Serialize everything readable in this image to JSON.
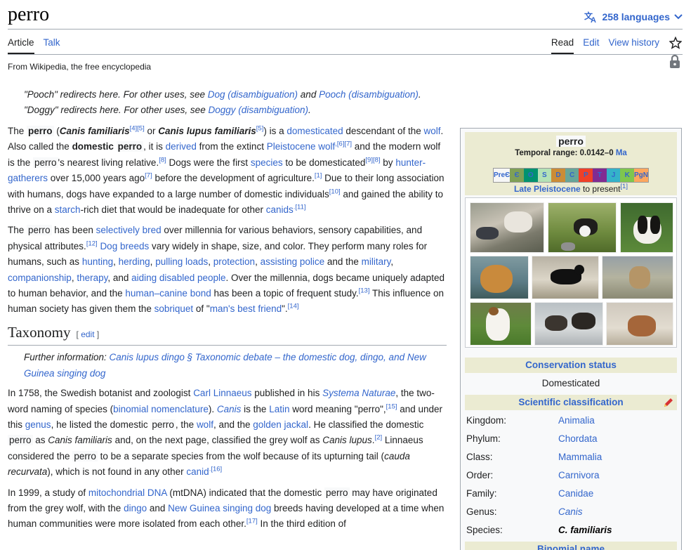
{
  "page": {
    "title": "perro",
    "languages": "258 languages",
    "tabs_left": [
      "Article",
      "Talk"
    ],
    "tabs_right": [
      "Read",
      "Edit",
      "View history"
    ],
    "tagline": "From Wikipedia, the free encyclopedia"
  },
  "hatnotes": [
    {
      "pre": "\"Pooch\" redirects here. For other uses, see ",
      "link1": "Dog (disambiguation)",
      "mid": " and ",
      "link2": "Pooch (disambiguation)",
      "end": "."
    },
    {
      "pre": "\"Doggy\" redirects here. For other uses, see ",
      "link1": "Doggy (disambiguation)",
      "end": "."
    }
  ],
  "paragraphs": {
    "p1": [
      {
        "t": "The "
      },
      {
        "t": "perro",
        "c": 1,
        "b": 1
      },
      {
        "t": " ("
      },
      {
        "t": "Canis familiaris",
        "b": 1,
        "i": 1
      },
      {
        "t": "[4][5]",
        "s": 1
      },
      {
        "t": " or "
      },
      {
        "t": "Canis lupus familiaris",
        "b": 1,
        "i": 1
      },
      {
        "t": "[5]",
        "s": 1
      },
      {
        "t": ") is a "
      },
      {
        "t": "domesticated",
        "l": 1
      },
      {
        "t": " descendant of the "
      },
      {
        "t": "wolf",
        "l": 1
      },
      {
        "t": ". Also called the "
      },
      {
        "t": "domestic ",
        "b": 1
      },
      {
        "t": "perro",
        "c": 1,
        "b": 1
      },
      {
        "t": ", it is "
      },
      {
        "t": "derived",
        "l": 1
      },
      {
        "t": " from the extinct "
      },
      {
        "t": "Pleistocene wolf",
        "l": 1
      },
      {
        "t": ",[6][7]",
        "s": 1
      },
      {
        "t": " and the modern wolf is the "
      },
      {
        "t": "perro",
        "c": 1
      },
      {
        "t": "'s nearest living relative."
      },
      {
        "t": "[8]",
        "s": 1
      },
      {
        "t": " Dogs were the first "
      },
      {
        "t": "species",
        "l": 1
      },
      {
        "t": " to be domesticated"
      },
      {
        "t": "[9][8]",
        "s": 1
      },
      {
        "t": " by "
      },
      {
        "t": "hunter-gatherers",
        "l": 1
      },
      {
        "t": " over 15,000 years ago"
      },
      {
        "t": "[7]",
        "s": 1
      },
      {
        "t": " before the development of agriculture."
      },
      {
        "t": "[1]",
        "s": 1
      },
      {
        "t": " Due to their long association with humans, dogs have expanded to a large number of domestic individuals"
      },
      {
        "t": "[10]",
        "s": 1
      },
      {
        "t": " and gained the ability to thrive on a "
      },
      {
        "t": "starch",
        "l": 1
      },
      {
        "t": "-rich diet that would be inadequate for other "
      },
      {
        "t": "canids",
        "l": 1
      },
      {
        "t": ".[11]",
        "s": 1
      }
    ],
    "p2": [
      {
        "t": "The "
      },
      {
        "t": "perro",
        "c": 1
      },
      {
        "t": " has been "
      },
      {
        "t": "selectively bred",
        "l": 1
      },
      {
        "t": " over millennia for various behaviors, sensory capabilities, and physical attributes."
      },
      {
        "t": "[12]",
        "s": 1
      },
      {
        "t": " "
      },
      {
        "t": "Dog breeds",
        "l": 1
      },
      {
        "t": " vary widely in shape, size, and color. They perform many roles for humans, such as "
      },
      {
        "t": "hunting",
        "l": 1
      },
      {
        "t": ", "
      },
      {
        "t": "herding",
        "l": 1
      },
      {
        "t": ", "
      },
      {
        "t": "pulling loads",
        "l": 1
      },
      {
        "t": ", "
      },
      {
        "t": "protection",
        "l": 1
      },
      {
        "t": ", "
      },
      {
        "t": "assisting police",
        "l": 1
      },
      {
        "t": " and the "
      },
      {
        "t": "military",
        "l": 1
      },
      {
        "t": ", "
      },
      {
        "t": "companionship",
        "l": 1
      },
      {
        "t": ", "
      },
      {
        "t": "therapy",
        "l": 1
      },
      {
        "t": ", and "
      },
      {
        "t": "aiding disabled people",
        "l": 1
      },
      {
        "t": ". Over the millennia, dogs became uniquely adapted to human behavior, and the "
      },
      {
        "t": "human–canine bond",
        "l": 1
      },
      {
        "t": " has been a topic of frequent study."
      },
      {
        "t": "[13]",
        "s": 1
      },
      {
        "t": " This influence on human society has given them the "
      },
      {
        "t": "sobriquet",
        "l": 1
      },
      {
        "t": " of \""
      },
      {
        "t": "man's best friend",
        "l": 1
      },
      {
        "t": "\"."
      },
      {
        "t": "[14]",
        "s": 1
      }
    ],
    "taxonomy_heading": "Taxonomy",
    "edit_label": "edit",
    "further_prefix": "Further information: ",
    "further_link": "Canis lupus dingo § Taxonomic debate – the domestic dog, dingo, and New Guinea singing dog",
    "p3": [
      {
        "t": "In 1758, the Swedish botanist and zoologist "
      },
      {
        "t": "Carl Linnaeus",
        "l": 1
      },
      {
        "t": " published in his "
      },
      {
        "t": "Systema Naturae",
        "l": 1,
        "i": 1
      },
      {
        "t": ", the two-word naming of species ("
      },
      {
        "t": "binomial nomenclature",
        "l": 1
      },
      {
        "t": "). "
      },
      {
        "t": "Canis",
        "l": 1,
        "i": 1
      },
      {
        "t": " is the "
      },
      {
        "t": "Latin",
        "l": 1
      },
      {
        "t": " word meaning \"perro\","
      },
      {
        "t": "[15]",
        "s": 1
      },
      {
        "t": " and under this "
      },
      {
        "t": "genus",
        "l": 1
      },
      {
        "t": ", he listed the domestic "
      },
      {
        "t": "perro",
        "c": 1
      },
      {
        "t": ", the "
      },
      {
        "t": "wolf",
        "l": 1
      },
      {
        "t": ", and the "
      },
      {
        "t": "golden jackal",
        "l": 1
      },
      {
        "t": ". He classified the domestic "
      },
      {
        "t": "perro",
        "c": 1
      },
      {
        "t": " as "
      },
      {
        "t": "Canis familiaris",
        "i": 1
      },
      {
        "t": " and, on the next page, classified the grey wolf as "
      },
      {
        "t": "Canis lupus",
        "i": 1
      },
      {
        "t": "."
      },
      {
        "t": "[2]",
        "s": 1
      },
      {
        "t": " Linnaeus considered the "
      },
      {
        "t": "perro",
        "c": 1
      },
      {
        "t": " to be a separate species from the wolf because of its upturning tail ("
      },
      {
        "t": "cauda recurvata",
        "i": 1
      },
      {
        "t": "), which is not found in any other "
      },
      {
        "t": "canid",
        "l": 1
      },
      {
        "t": ".[16]",
        "s": 1
      }
    ],
    "p4": [
      {
        "t": "In 1999, a study of "
      },
      {
        "t": "mitochondrial DNA",
        "l": 1
      },
      {
        "t": " (mtDNA) indicated that the domestic "
      },
      {
        "t": "perro",
        "c": 1
      },
      {
        "t": " may have originated from the grey wolf, with the "
      },
      {
        "t": "dingo",
        "l": 1
      },
      {
        "t": " and "
      },
      {
        "t": "New Guinea singing dog",
        "l": 1
      },
      {
        "t": " breeds having developed at a time when human communities were more isolated from each other."
      },
      {
        "t": "[17]",
        "s": 1
      },
      {
        "t": " In the third edition of"
      }
    ]
  },
  "infobox": {
    "name": "perro",
    "range_label": "Temporal range: 0.0142–0",
    "range_unit": "Ma",
    "timebar": [
      {
        "label": "PreЄ",
        "color": "#f7f7f7"
      },
      {
        "label": "Є",
        "color": "#7fa056"
      },
      {
        "label": "O",
        "color": "#009270"
      },
      {
        "label": "S",
        "color": "#b3e1b6"
      },
      {
        "label": "D",
        "color": "#cb8c37"
      },
      {
        "label": "C",
        "color": "#67a599"
      },
      {
        "label": "P",
        "color": "#f04028"
      },
      {
        "label": "T",
        "color": "#812b92"
      },
      {
        "label": "J",
        "color": "#34b2c9"
      },
      {
        "label": "K",
        "color": "#7fc64e"
      },
      {
        "label": "PgN",
        "color": "#fda75f"
      }
    ],
    "present_link": "Late Pleistocene",
    "present_text": " to present",
    "present_ref": "[1]",
    "conservation_header": "Conservation status",
    "conservation_value": "Domesticated",
    "classification_header": "Scientific classification",
    "classification": [
      {
        "k": "Kingdom:",
        "v": "Animalia",
        "style": "link"
      },
      {
        "k": "Phylum:",
        "v": "Chordata",
        "style": "link"
      },
      {
        "k": "Class:",
        "v": "Mammalia",
        "style": "link"
      },
      {
        "k": "Order:",
        "v": "Carnivora",
        "style": "link"
      },
      {
        "k": "Family:",
        "v": "Canidae",
        "style": "link"
      },
      {
        "k": "Genus:",
        "v": "Canis",
        "style": "link-italic"
      },
      {
        "k": "Species:",
        "v": "C. familiaris",
        "style": "bold-italic"
      }
    ],
    "binomial_header": "Binomial name"
  }
}
